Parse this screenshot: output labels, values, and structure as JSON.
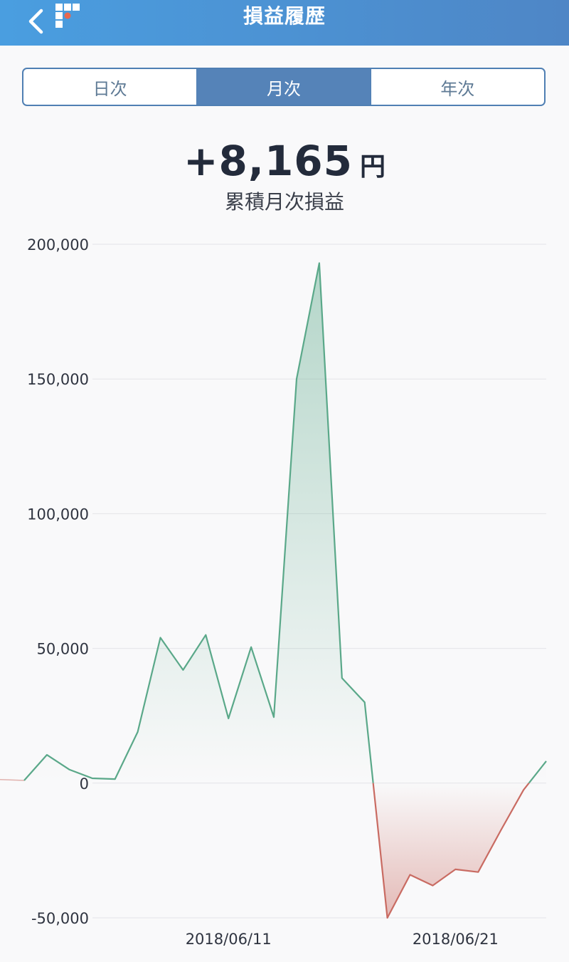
{
  "header": {
    "title": "損益履歴",
    "back_icon": "chevron-left-icon",
    "logo_icon": "brand-logo-icon"
  },
  "tabs": [
    {
      "label": "日次",
      "active": false
    },
    {
      "label": "月次",
      "active": true
    },
    {
      "label": "年次",
      "active": false
    }
  ],
  "summary": {
    "value": "+8,165",
    "unit": "円",
    "label": "累積月次損益"
  },
  "colors": {
    "header_start": "#4a9ee0",
    "header_end": "#4e86c6",
    "positive": "#5aa889",
    "negative": "#c96b62",
    "accent": "#5583b8"
  },
  "chart_data": {
    "type": "area",
    "title": "",
    "xlabel": "",
    "ylabel": "",
    "ylim": [
      -50000,
      200000
    ],
    "yticks": [
      "200,000",
      "150,000",
      "100,000",
      "50,000",
      "0",
      "-50,000"
    ],
    "xticks": [
      "2018/06/11",
      "2018/06/21"
    ],
    "grid": true,
    "series": [
      {
        "values": [
          1000,
          10500,
          5000,
          1800,
          1500,
          19000,
          54000,
          42000,
          55000,
          24000,
          50500,
          24500,
          150000,
          193000,
          39000,
          30000,
          -50000,
          -34000,
          -38000,
          -32000,
          -33000,
          -17500,
          -2500,
          8165
        ]
      }
    ]
  }
}
